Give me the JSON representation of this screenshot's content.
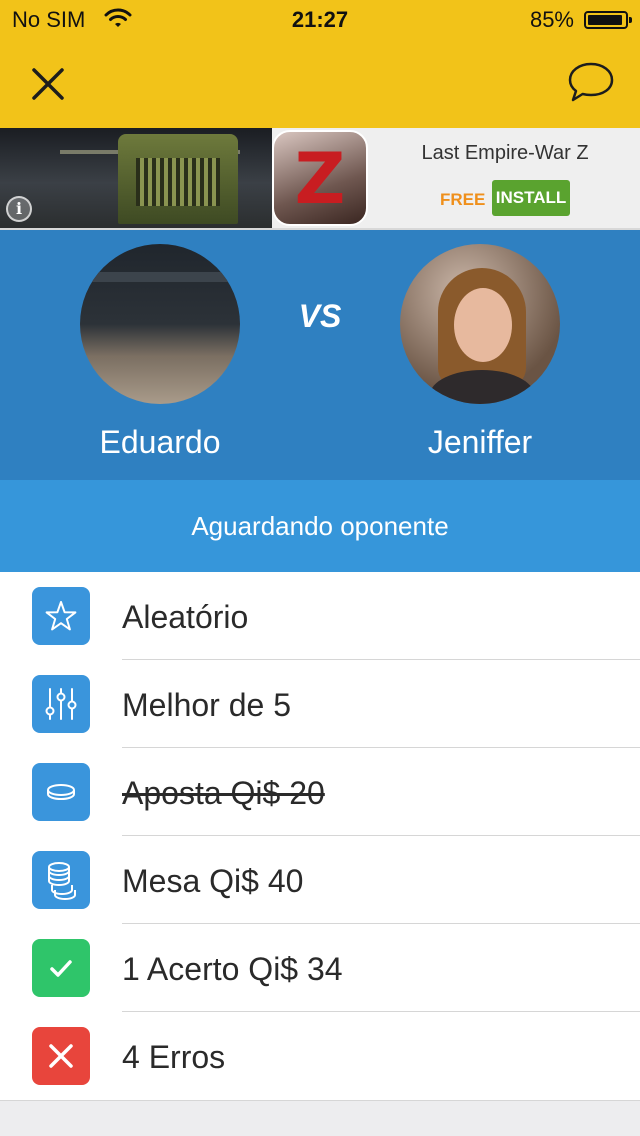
{
  "status_bar": {
    "carrier": "No SIM",
    "time": "21:27",
    "battery": "85%",
    "battery_level": 0.85
  },
  "header": {
    "close_icon": "close-icon",
    "chat_icon": "chat-bubble-icon",
    "background": "#f2c319"
  },
  "ad": {
    "title": "Last Empire-War Z",
    "price": "FREE",
    "install_label": "INSTALL",
    "info_icon": "info-icon",
    "info_glyph": "i",
    "app_icon_glyph": "Z"
  },
  "match": {
    "vs_label": "VS",
    "player_1": {
      "name": "Eduardo"
    },
    "player_2": {
      "name": "Jeniffer"
    },
    "status": "Aguardando oponente"
  },
  "details": [
    {
      "icon": "star-icon",
      "color": "#3a95dc",
      "label": "Aleatório"
    },
    {
      "icon": "sliders-icon",
      "color": "#3a95dc",
      "label": "Melhor de 5"
    },
    {
      "icon": "coin-icon",
      "color": "#3a95dc",
      "label": "Aposta Qi$ 20",
      "struck": true
    },
    {
      "icon": "coins-stack-icon",
      "color": "#3a95dc",
      "label": "Mesa Qi$ 40"
    },
    {
      "icon": "checkmark-icon",
      "color": "#2fc56a",
      "label": "1 Acerto Qi$ 34"
    },
    {
      "icon": "cross-icon",
      "color": "#e8453c",
      "label": "4 Erros"
    }
  ]
}
